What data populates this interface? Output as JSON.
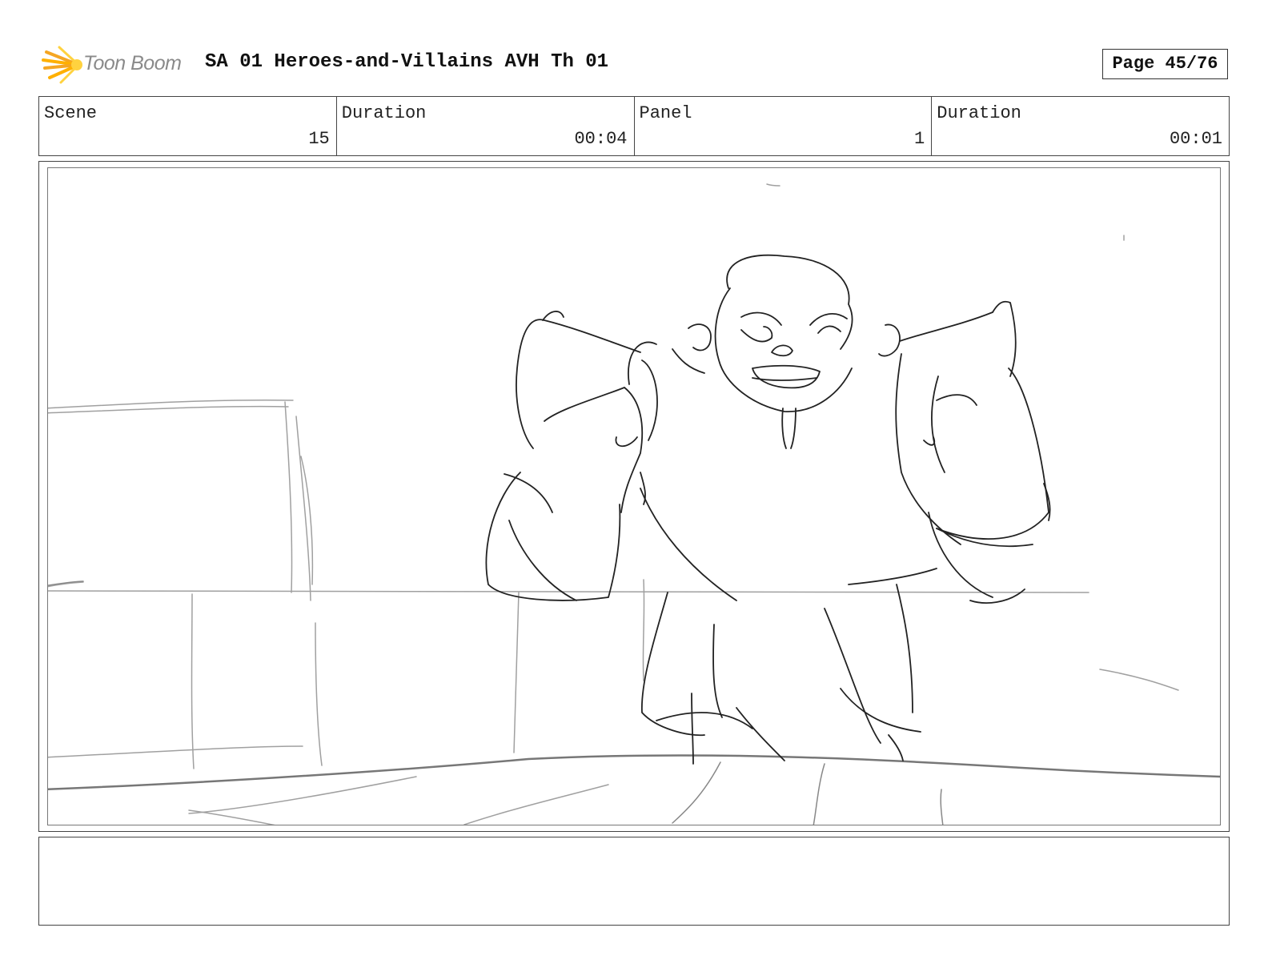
{
  "header": {
    "logo_text": "Toon Boom",
    "title": "SA 01 Heroes-and-Villains AVH Th 01",
    "page_label": "Page 45/76"
  },
  "info": [
    {
      "label": "Scene",
      "value": "15"
    },
    {
      "label": "Duration",
      "value": "00:04"
    },
    {
      "label": "Panel",
      "value": "1"
    },
    {
      "label": "Duration",
      "value": "00:01"
    }
  ],
  "notes": "",
  "colors": {
    "logo_orange": "#f5a623",
    "logo_yellow": "#ffd23f",
    "sketch_dark": "#222222",
    "sketch_light": "#9a9a9a"
  }
}
